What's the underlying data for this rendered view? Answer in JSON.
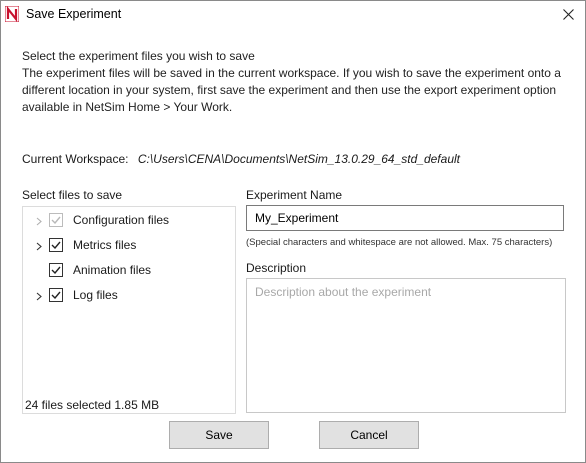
{
  "window": {
    "title": "Save Experiment",
    "app_icon": "netsim-logo-icon",
    "close_icon": "close-icon"
  },
  "intro": {
    "line1": "Select the experiment files you wish to save",
    "line2": "The experiment files will be saved in the current workspace. If you wish to save the experiment onto a",
    "line3": "different location in your system, first save the experiment and then use the export experiment option",
    "line4": "available in NetSim Home > Your Work."
  },
  "workspace": {
    "label": "Current Workspace:",
    "path": "C:\\Users\\CENA\\Documents\\NetSim_13.0.29_64_std_default"
  },
  "files": {
    "label": "Select files to save",
    "items": [
      {
        "label": "Configuration files",
        "checked": true,
        "disabled": true,
        "expandable": true
      },
      {
        "label": "Metrics files",
        "checked": true,
        "disabled": false,
        "expandable": true
      },
      {
        "label": "Animation files",
        "checked": true,
        "disabled": false,
        "expandable": false
      },
      {
        "label": "Log files",
        "checked": true,
        "disabled": false,
        "expandable": true
      }
    ],
    "summary": "24 files selected 1.85 MB"
  },
  "experiment_name": {
    "label": "Experiment Name",
    "value": "My_Experiment",
    "hint": "(Special characters and whitespace are not allowed. Max. 75 characters)"
  },
  "description": {
    "label": "Description",
    "placeholder": "Description about the experiment",
    "value": ""
  },
  "buttons": {
    "save": "Save",
    "cancel": "Cancel"
  },
  "colors": {
    "button_bg": "#e1e1e1",
    "logo_red": "#c8102e"
  }
}
